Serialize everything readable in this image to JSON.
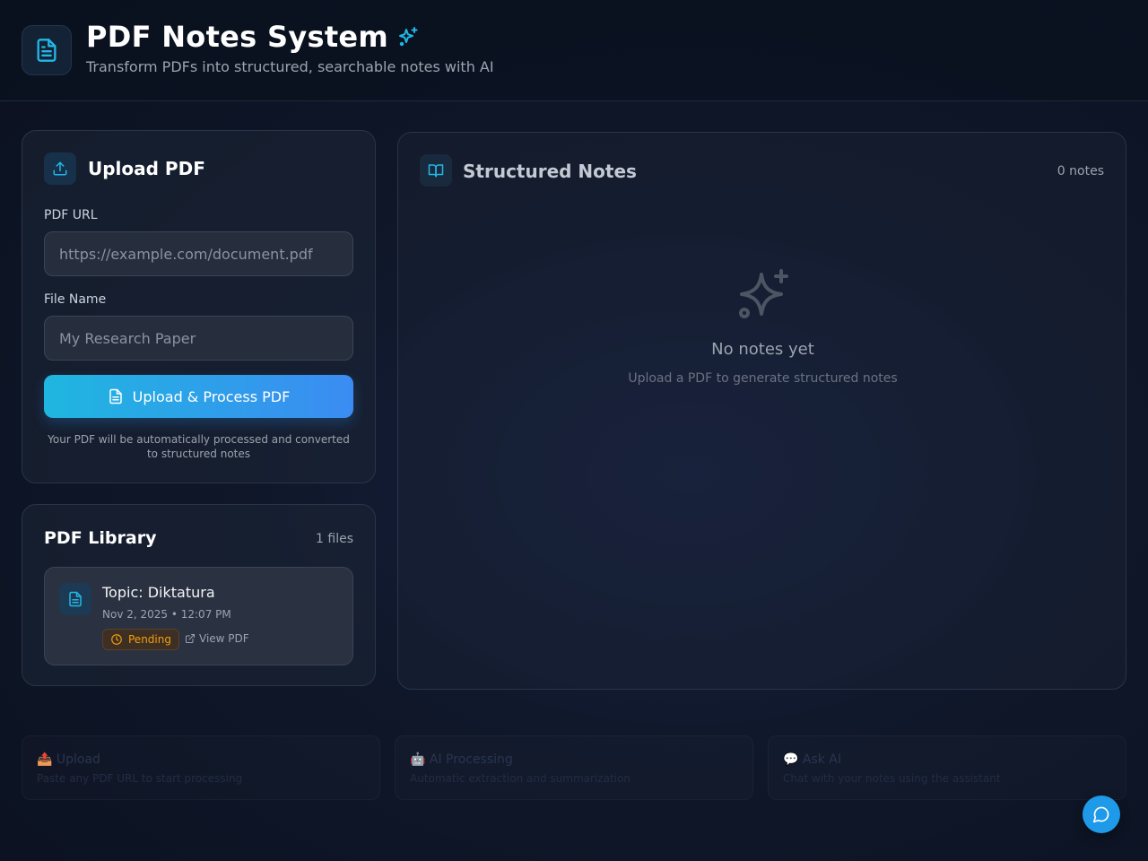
{
  "header": {
    "title": "PDF Notes System",
    "subtitle": "Transform PDFs into structured, searchable notes with AI",
    "logo_icon": "document-icon",
    "title_icon": "sparkles-icon"
  },
  "upload": {
    "title": "Upload PDF",
    "icon": "upload-icon",
    "url_label": "PDF URL",
    "url_placeholder": "https://example.com/document.pdf",
    "url_value": "",
    "name_label": "File Name",
    "name_placeholder": "My Research Paper",
    "name_value": "",
    "button_label": "Upload & Process PDF",
    "helper": "Your PDF will be automatically processed and converted to structured notes"
  },
  "library": {
    "title": "PDF Library",
    "count": "1 files",
    "files": [
      {
        "name": "Topic: Diktatura",
        "date": "Nov 2, 2025 • 12:07 PM",
        "status": "Pending",
        "link": "View PDF"
      }
    ]
  },
  "notes": {
    "title": "Structured Notes",
    "icon": "book-open-icon",
    "count": "0 notes",
    "empty_title": "No notes yet",
    "empty_subtitle": "Upload a PDF to generate structured notes"
  },
  "features": [
    {
      "title": "📤 Upload",
      "desc": "Paste any PDF URL to start processing"
    },
    {
      "title": "🤖 AI Processing",
      "desc": "Automatic extraction and summarization"
    },
    {
      "title": "💬 Ask AI",
      "desc": "Chat with your notes using the assistant"
    }
  ],
  "colors": {
    "accent": "#22b8e6",
    "button_gradient_start": "#1fb6e0",
    "button_gradient_end": "#3b8cf2",
    "pending": "#f59e0b",
    "background": "#0f1729"
  },
  "chat_button_icon": "chat-bubble-icon"
}
